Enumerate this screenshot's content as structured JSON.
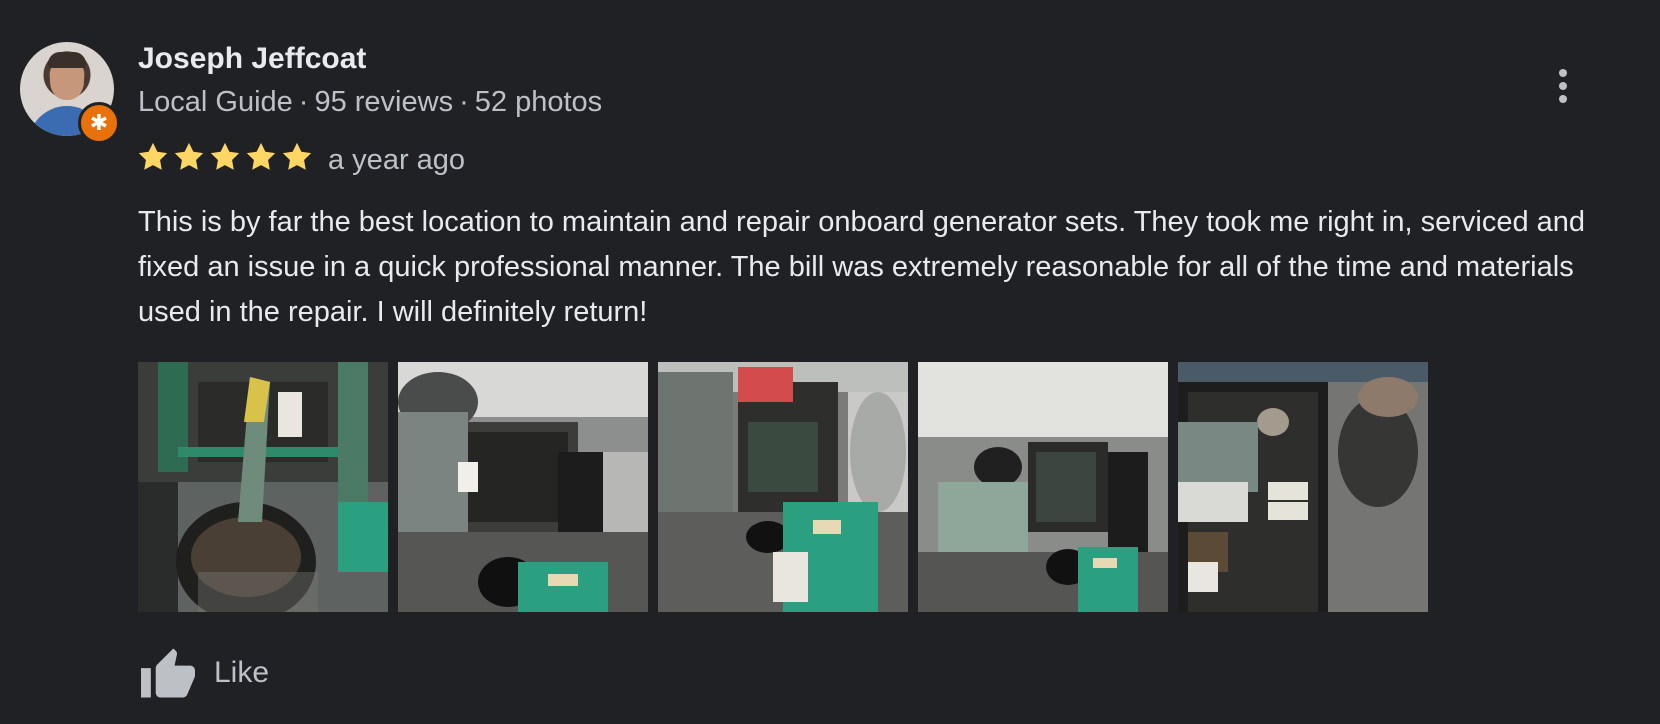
{
  "reviewer": {
    "name": "Joseph Jeffcoat",
    "badge": "Local Guide",
    "reviews": "95 reviews",
    "photos": "52 photos",
    "separator": "·"
  },
  "rating": {
    "stars": 5,
    "max_stars": 5,
    "star_color": "#fdd663",
    "time": "a year ago"
  },
  "review_text": "This is by far the best location to maintain and repair onboard generator sets. They took me right in, serviced and fixed an issue in a quick professional manner. The bill was extremely reasonable for all of the time and materials used in the repair. I will definitely return!",
  "photos": [
    {
      "icon": "photo-thumbnail"
    },
    {
      "icon": "photo-thumbnail"
    },
    {
      "icon": "photo-thumbnail"
    },
    {
      "icon": "photo-thumbnail"
    },
    {
      "icon": "photo-thumbnail"
    }
  ],
  "actions": {
    "like_label": "Like",
    "like_icon": "thumbs-up-icon",
    "more_icon": "more-vert-icon"
  },
  "colors": {
    "background": "#202124",
    "primary_text": "#e8eaed",
    "secondary_text": "#bdc1c6",
    "local_guide_badge": "#e8710a"
  }
}
